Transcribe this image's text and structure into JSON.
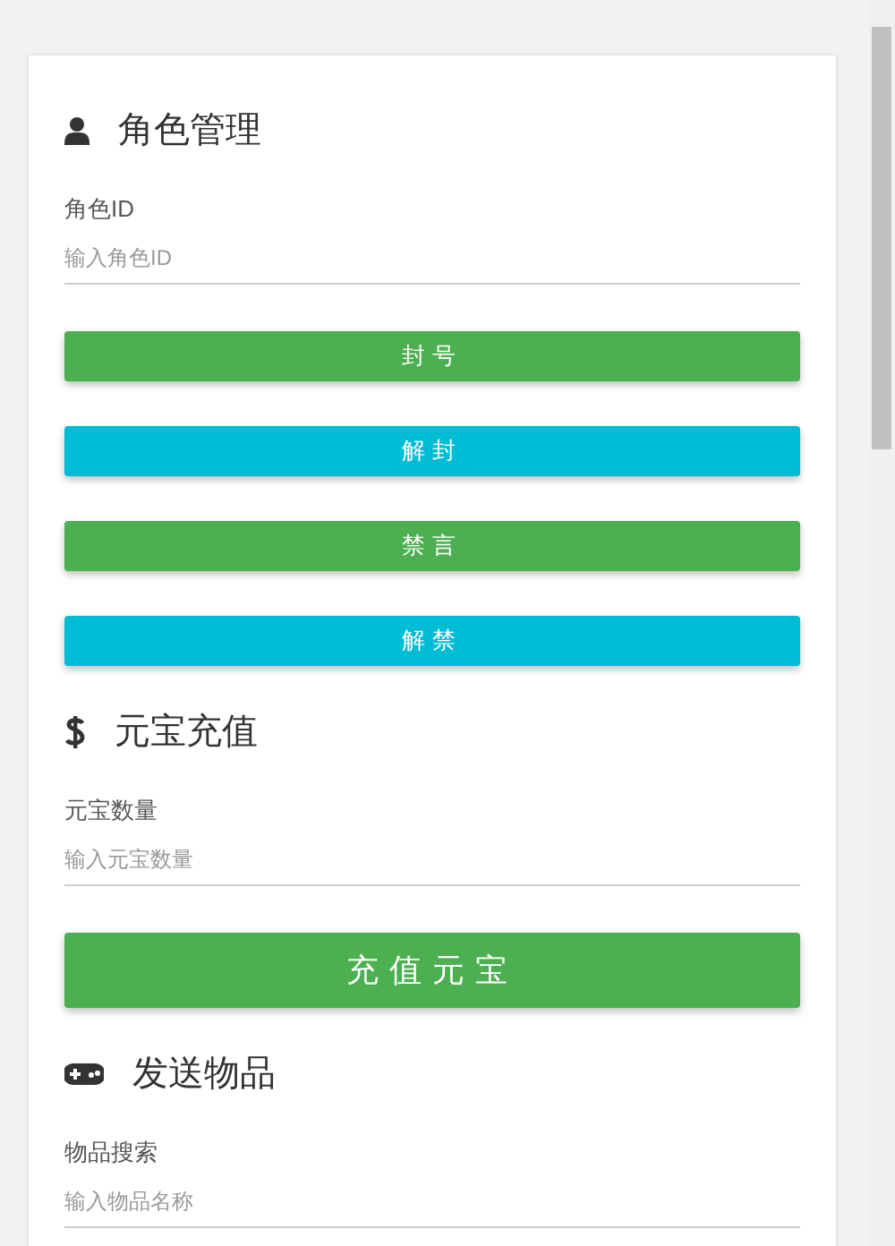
{
  "sections": [
    {
      "kind": "user",
      "title": "角色管理",
      "items": [
        {
          "kind": "field",
          "label": "角色ID",
          "placeholder": "输入角色ID"
        },
        {
          "kind": "button",
          "label": "封号",
          "color": "#4caf50"
        },
        {
          "kind": "button",
          "label": "解封",
          "color": "#00bcd4"
        },
        {
          "kind": "button",
          "label": "禁言",
          "color": "#4caf50"
        },
        {
          "kind": "button",
          "label": "解禁",
          "color": "#00bcd4"
        }
      ]
    },
    {
      "kind": "dollar",
      "title": "元宝充值",
      "items": [
        {
          "kind": "field",
          "label": "元宝数量",
          "placeholder": "输入元宝数量"
        },
        {
          "kind": "big-button",
          "label": "充值元宝",
          "color": "#4caf50"
        }
      ]
    },
    {
      "kind": "gamepad",
      "title": "发送物品",
      "items": [
        {
          "kind": "field",
          "label": "物品搜索",
          "placeholder": "输入物品名称"
        }
      ]
    }
  ]
}
